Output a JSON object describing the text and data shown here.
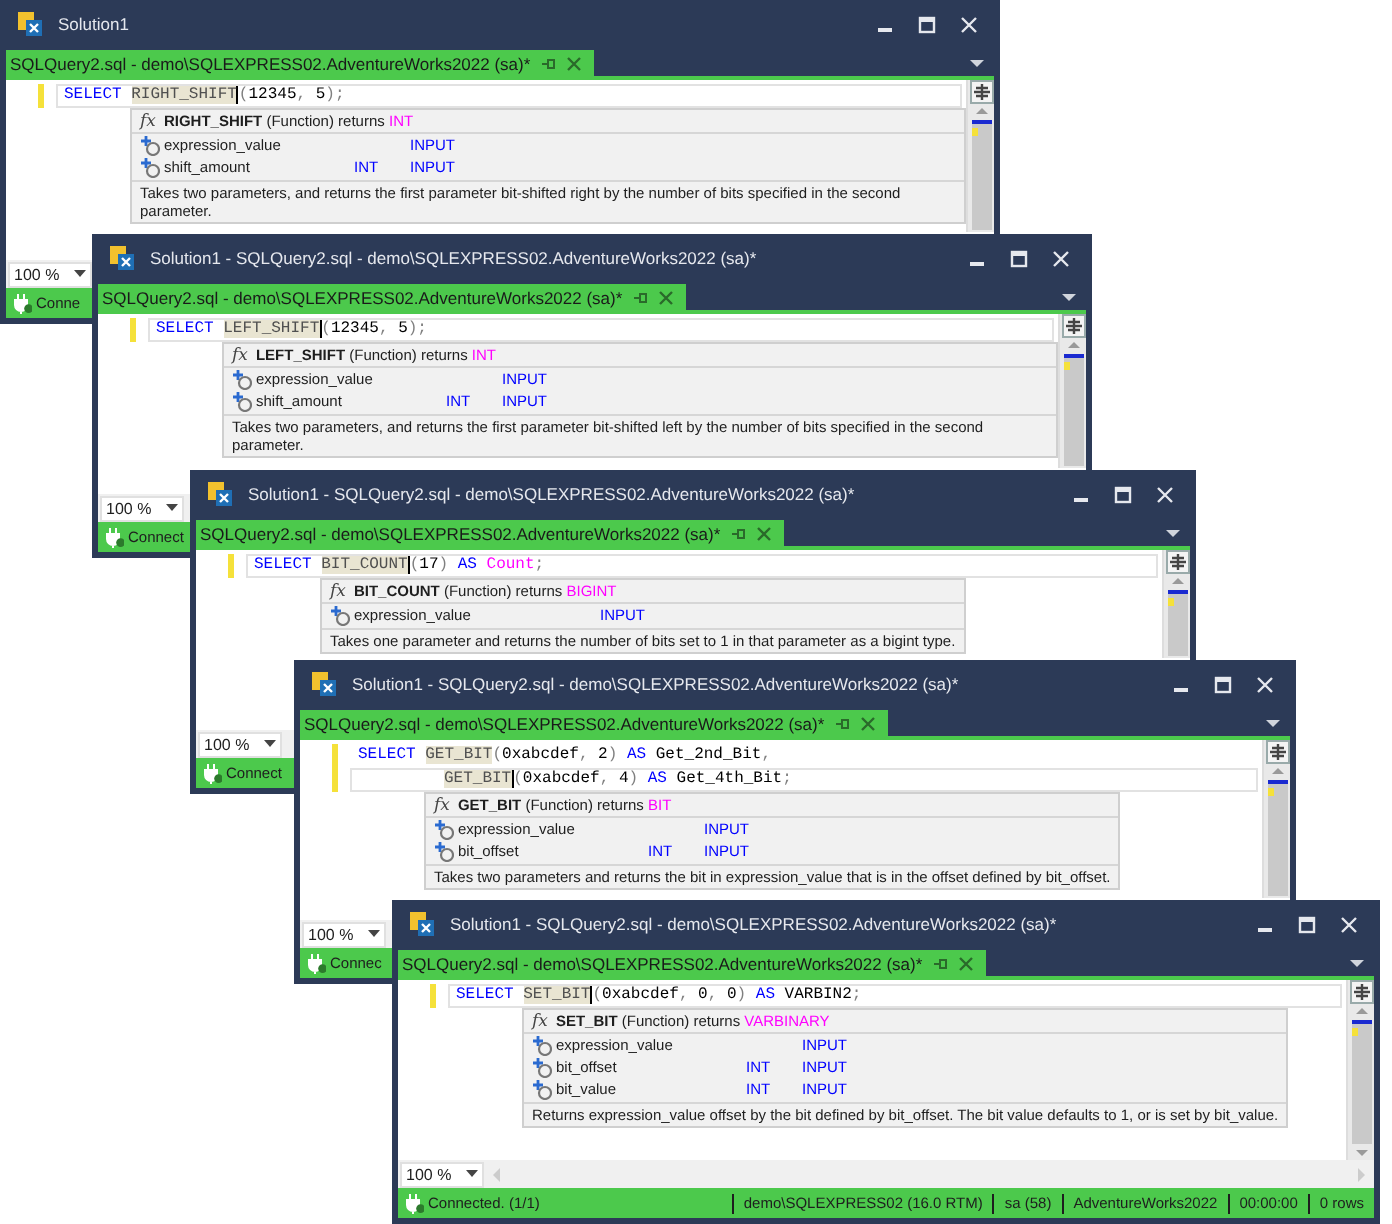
{
  "windows": [
    {
      "title": "Solution1",
      "tab": "SQLQuery2.sql - demo\\SQLEXPRESS02.AdventureWorks2022 (sa)*",
      "code": [
        {
          "current": true,
          "indented": false,
          "tokens": [
            {
              "text": "SELECT ",
              "kind": "keyword"
            },
            {
              "text": "RIGHT_SHIFT",
              "kind": "function"
            },
            {
              "text": "(",
              "kind": "punct"
            },
            {
              "text": "12345",
              "kind": "literal"
            },
            {
              "text": ", ",
              "kind": "punct"
            },
            {
              "text": "5",
              "kind": "literal"
            },
            {
              "text": ");",
              "kind": "punct"
            }
          ]
        }
      ],
      "tooltip": {
        "symbol": "fx",
        "name": "RIGHT_SHIFT",
        "label": "(Function) returns",
        "returns": "INT",
        "params": [
          {
            "name": "expression_value",
            "direction": "INPUT"
          },
          {
            "name": "shift_amount",
            "type": "INT",
            "direction": "INPUT"
          }
        ],
        "description": "Takes two parameters, and returns the first parameter bit-shifted right by the number of bits specified in the second parameter."
      },
      "zoom": "100 %",
      "status": [
        "Conne"
      ]
    },
    {
      "title": "Solution1 - SQLQuery2.sql - demo\\SQLEXPRESS02.AdventureWorks2022 (sa)*",
      "tab": "SQLQuery2.sql - demo\\SQLEXPRESS02.AdventureWorks2022 (sa)*",
      "code": [
        {
          "current": true,
          "indented": false,
          "tokens": [
            {
              "text": "SELECT ",
              "kind": "keyword"
            },
            {
              "text": "LEFT_SHIFT",
              "kind": "function"
            },
            {
              "text": "(",
              "kind": "punct"
            },
            {
              "text": "12345",
              "kind": "literal"
            },
            {
              "text": ", ",
              "kind": "punct"
            },
            {
              "text": "5",
              "kind": "literal"
            },
            {
              "text": ");",
              "kind": "punct"
            }
          ]
        }
      ],
      "tooltip": {
        "symbol": "fx",
        "name": "LEFT_SHIFT",
        "label": "(Function) returns",
        "returns": "INT",
        "params": [
          {
            "name": "expression_value",
            "direction": "INPUT"
          },
          {
            "name": "shift_amount",
            "type": "INT",
            "direction": "INPUT"
          }
        ],
        "description": "Takes two parameters, and returns the first parameter bit-shifted left by the number of bits specified in the second parameter."
      },
      "zoom": "100 %",
      "status": [
        "Connect"
      ]
    },
    {
      "title": "Solution1 - SQLQuery2.sql - demo\\SQLEXPRESS02.AdventureWorks2022 (sa)*",
      "tab": "SQLQuery2.sql - demo\\SQLEXPRESS02.AdventureWorks2022 (sa)*",
      "code": [
        {
          "current": true,
          "indented": false,
          "tokens": [
            {
              "text": "SELECT ",
              "kind": "keyword"
            },
            {
              "text": "BIT_COUNT",
              "kind": "function"
            },
            {
              "text": "(",
              "kind": "punct"
            },
            {
              "text": "17",
              "kind": "literal"
            },
            {
              "text": ") ",
              "kind": "punct"
            },
            {
              "text": "AS ",
              "kind": "keyword"
            },
            {
              "text": "Count",
              "kind": "alias"
            },
            {
              "text": ";",
              "kind": "punct"
            }
          ]
        }
      ],
      "tooltip": {
        "symbol": "fx",
        "name": "BIT_COUNT",
        "label": "(Function) returns",
        "returns": "BIGINT",
        "params": [
          {
            "name": "expression_value",
            "direction": "INPUT"
          }
        ],
        "description": "Takes one parameter and returns the number of bits set to 1 in that parameter as a bigint type."
      },
      "zoom": "100 %",
      "status": [
        "Connect"
      ]
    },
    {
      "title": "Solution1 - SQLQuery2.sql - demo\\SQLEXPRESS02.AdventureWorks2022 (sa)*",
      "tab": "SQLQuery2.sql - demo\\SQLEXPRESS02.AdventureWorks2022 (sa)*",
      "code": [
        {
          "current": false,
          "indented": false,
          "tokens": [
            {
              "text": "SELECT ",
              "kind": "keyword"
            },
            {
              "text": "GET_BIT",
              "kind": "function"
            },
            {
              "text": "(",
              "kind": "punct"
            },
            {
              "text": "0xabcdef",
              "kind": "literal"
            },
            {
              "text": ", ",
              "kind": "punct"
            },
            {
              "text": "2",
              "kind": "literal"
            },
            {
              "text": ") ",
              "kind": "punct"
            },
            {
              "text": "AS ",
              "kind": "keyword"
            },
            {
              "text": "Get_2nd_Bit",
              "kind": "literal"
            },
            {
              "text": ",",
              "kind": "punct"
            }
          ]
        },
        {
          "current": true,
          "indented": true,
          "tokens": [
            {
              "text": "GET_BIT",
              "kind": "function"
            },
            {
              "text": "(",
              "kind": "punct"
            },
            {
              "text": "0xabcdef",
              "kind": "literal"
            },
            {
              "text": ", ",
              "kind": "punct"
            },
            {
              "text": "4",
              "kind": "literal"
            },
            {
              "text": ") ",
              "kind": "punct"
            },
            {
              "text": "AS ",
              "kind": "keyword"
            },
            {
              "text": "Get_4th_Bit",
              "kind": "literal"
            },
            {
              "text": ";",
              "kind": "punct"
            }
          ]
        }
      ],
      "tooltip": {
        "symbol": "fx",
        "name": "GET_BIT",
        "label": "(Function) returns",
        "returns": "BIT",
        "params": [
          {
            "name": "expression_value",
            "direction": "INPUT"
          },
          {
            "name": "bit_offset",
            "type": "INT",
            "direction": "INPUT"
          }
        ],
        "description": "Takes two parameters and returns the bit in expression_value that is in the offset defined by bit_offset."
      },
      "zoom": "100 %",
      "status": [
        "Connec"
      ]
    },
    {
      "title": "Solution1 - SQLQuery2.sql - demo\\SQLEXPRESS02.AdventureWorks2022 (sa)*",
      "tab": "SQLQuery2.sql - demo\\SQLEXPRESS02.AdventureWorks2022 (sa)*",
      "code": [
        {
          "current": true,
          "indented": false,
          "tokens": [
            {
              "text": "SELECT ",
              "kind": "keyword"
            },
            {
              "text": "SET_BIT",
              "kind": "function"
            },
            {
              "text": "(",
              "kind": "punct"
            },
            {
              "text": "0xabcdef",
              "kind": "literal"
            },
            {
              "text": ", ",
              "kind": "punct"
            },
            {
              "text": "0",
              "kind": "literal"
            },
            {
              "text": ", ",
              "kind": "punct"
            },
            {
              "text": "0",
              "kind": "literal"
            },
            {
              "text": ") ",
              "kind": "punct"
            },
            {
              "text": "AS ",
              "kind": "keyword"
            },
            {
              "text": "VARBIN2",
              "kind": "literal"
            },
            {
              "text": ";",
              "kind": "punct"
            }
          ]
        }
      ],
      "tooltip": {
        "symbol": "fx",
        "name": "SET_BIT",
        "label": "(Function) returns",
        "returns": "VARBINARY",
        "params": [
          {
            "name": "expression_value",
            "direction": "INPUT"
          },
          {
            "name": "bit_offset",
            "type": "INT",
            "direction": "INPUT"
          },
          {
            "name": "bit_value",
            "type": "INT",
            "direction": "INPUT"
          }
        ],
        "description": "Returns expression_value offset by the bit defined by bit_offset. The bit value defaults to 1, or is set by bit_value."
      },
      "zoom": "100 %",
      "status": [
        "Connected. (1/1)",
        "demo\\SQLEXPRESS02 (16.0 RTM)",
        "sa (58)",
        "AdventureWorks2022",
        "00:00:00",
        "0 rows"
      ]
    }
  ]
}
